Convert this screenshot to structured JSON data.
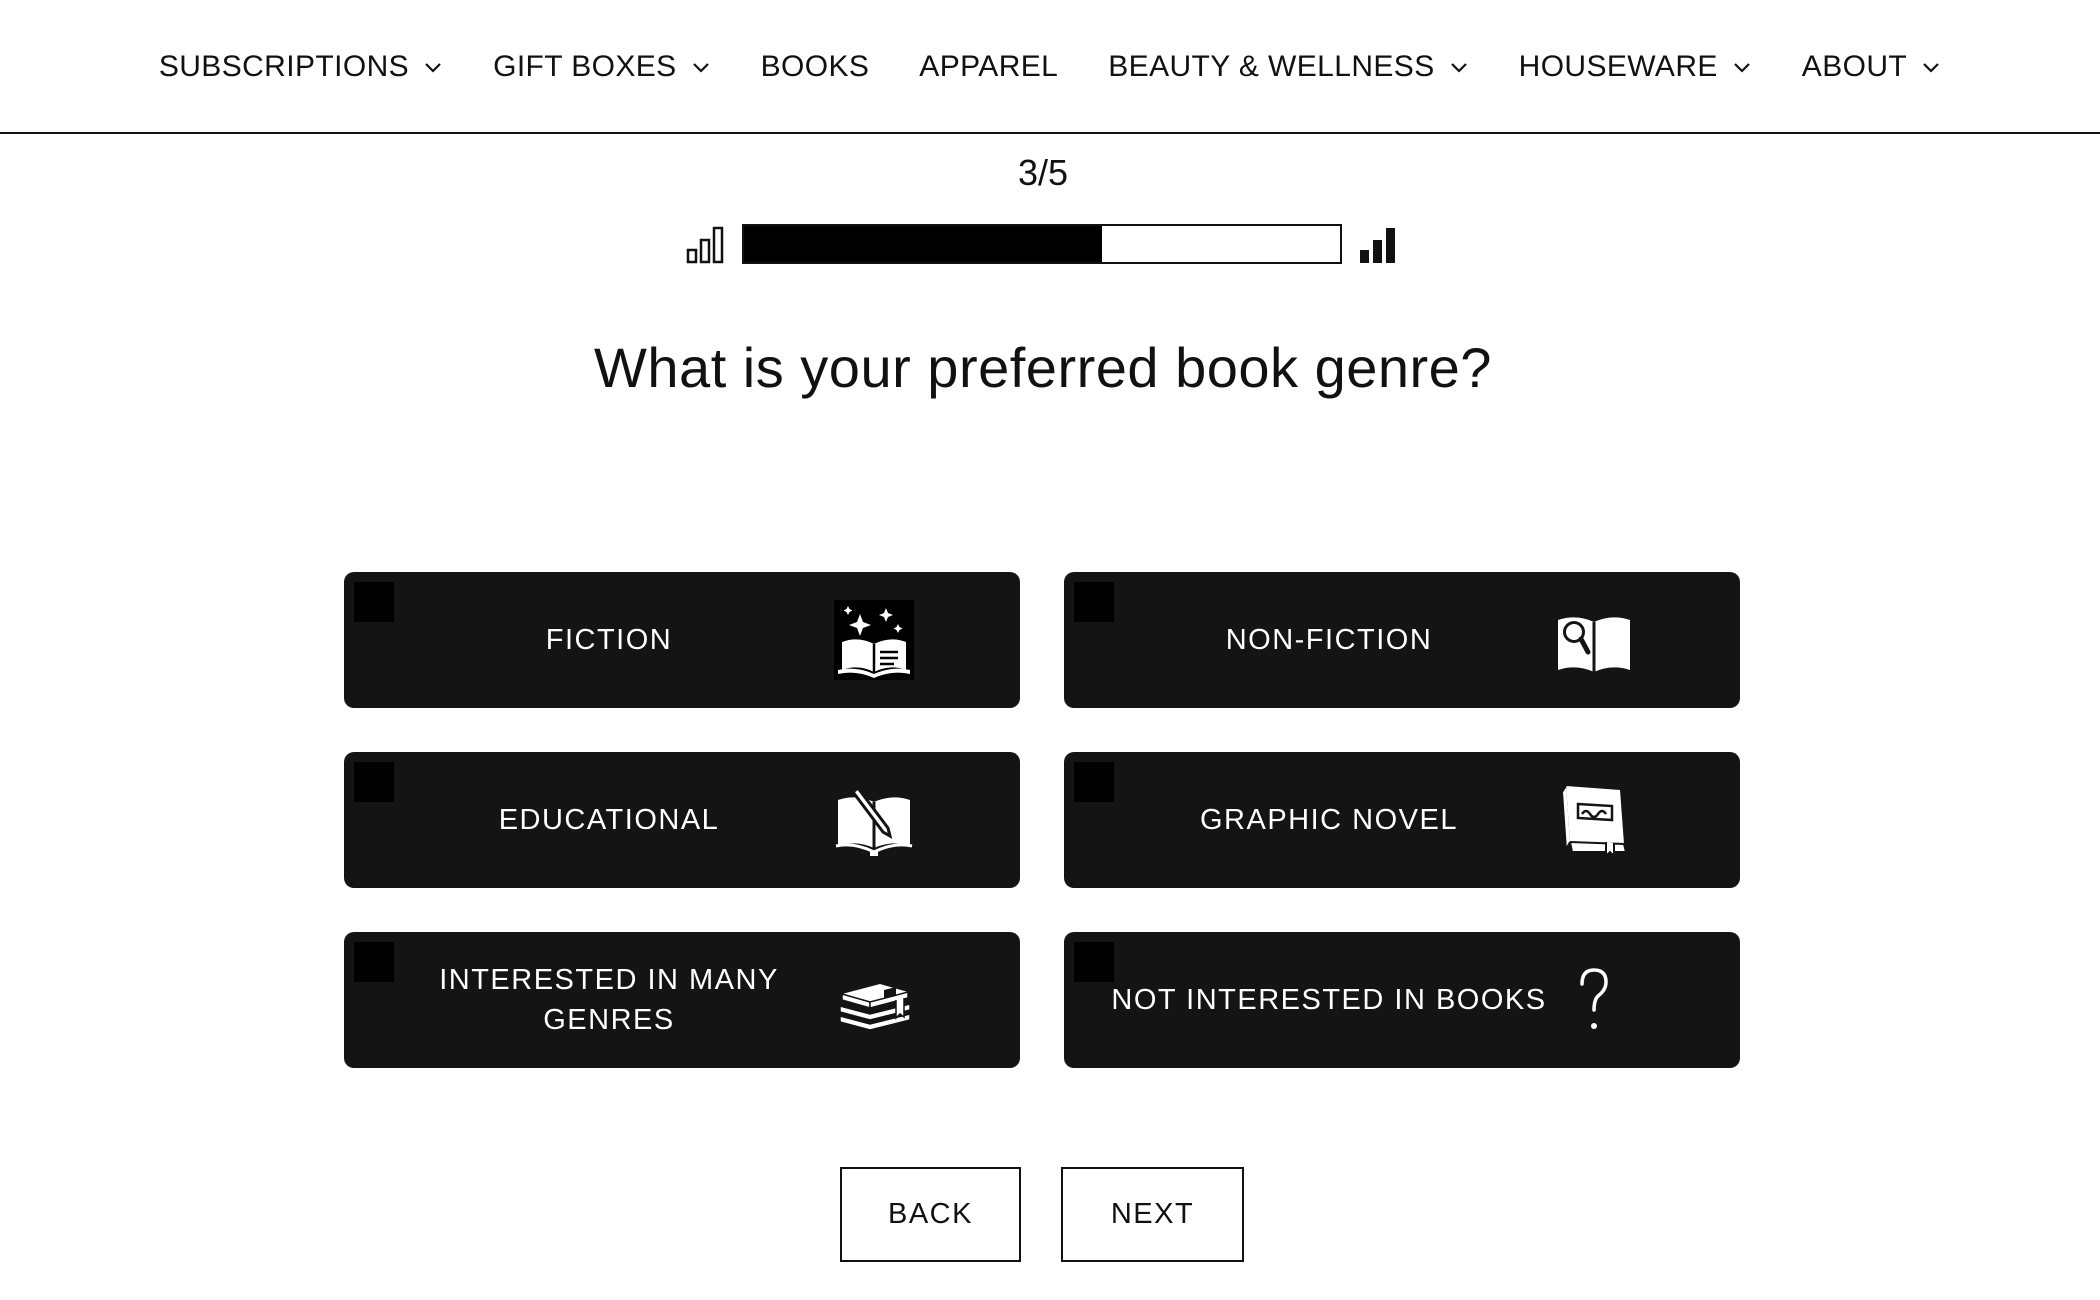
{
  "nav": {
    "items": [
      {
        "label": "SUBSCRIPTIONS",
        "has_dropdown": true
      },
      {
        "label": "GIFT BOXES",
        "has_dropdown": true
      },
      {
        "label": "BOOKS",
        "has_dropdown": false
      },
      {
        "label": "APPAREL",
        "has_dropdown": false
      },
      {
        "label": "BEAUTY & WELLNESS",
        "has_dropdown": true
      },
      {
        "label": "HOUSEWARE",
        "has_dropdown": true
      },
      {
        "label": "ABOUT",
        "has_dropdown": true
      }
    ]
  },
  "progress": {
    "step_text": "3/5",
    "fraction": 0.6
  },
  "question": "What is your preferred book genre?",
  "options": [
    {
      "label": "FICTION",
      "icon": "magic-book-icon",
      "checked": false
    },
    {
      "label": "NON-FICTION",
      "icon": "book-magnifier-icon",
      "checked": false
    },
    {
      "label": "EDUCATIONAL",
      "icon": "book-pencil-icon",
      "checked": false
    },
    {
      "label": "GRAPHIC NOVEL",
      "icon": "comic-book-icon",
      "checked": false
    },
    {
      "label": "INTERESTED IN MANY GENRES",
      "icon": "book-stack-icon",
      "checked": false
    },
    {
      "label": "NOT INTERESTED IN BOOKS",
      "icon": "question-mark-icon",
      "checked": false
    }
  ],
  "buttons": {
    "back": "BACK",
    "next": "NEXT"
  },
  "colors": {
    "option_bg": "#141414",
    "text": "#111111",
    "option_text": "#ffffff"
  }
}
